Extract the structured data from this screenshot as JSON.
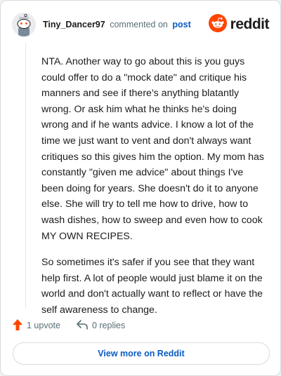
{
  "header": {
    "username": "Tiny_Dancer97",
    "action_text": "commented on",
    "post_link": "post",
    "brand": "reddit"
  },
  "comment": {
    "paragraphs": [
      "NTA. Another way to go about this is you guys could offer to do a \"mock date\" and critique his manners and see if there's anything blatantly wrong. Or ask him what he thinks he's doing wrong and if he wants advice. I know a lot of the time we just want to vent and don't always want critiques so this gives him the option. My mom has constantly \"given me advice\" about things I've been doing for years. She doesn't do it to anyone else. She will try to tell me how to drive, how to wash dishes, how to sweep and even how to cook MY OWN RECIPES.",
      "So sometimes it's safer if you see that they want help first. A lot of people would just blame it on the world and don't actually want to reflect or have the self awareness to change."
    ]
  },
  "actions": {
    "upvote_label": "1 upvote",
    "replies_label": "0 replies"
  },
  "footer": {
    "view_more_label": "View more on Reddit"
  },
  "colors": {
    "reddit_orange": "#ff4500",
    "link_blue": "#0a5bc4",
    "muted_text": "#576f76"
  },
  "icons": {
    "avatar": "snoo-avatar-icon",
    "brand": "reddit-logo-icon",
    "upvote": "upvote-arrow-icon",
    "reply": "reply-arrow-icon"
  }
}
